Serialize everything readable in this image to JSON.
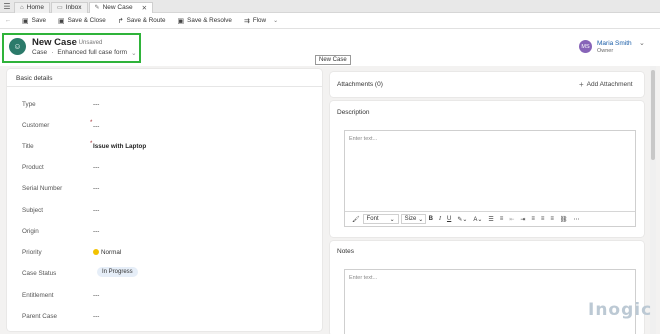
{
  "tabs": [
    {
      "label": "Home",
      "icon": "home-icon"
    },
    {
      "label": "Inbox",
      "icon": "inbox-icon"
    },
    {
      "label": "New Case",
      "icon": "edit-icon",
      "active": true
    }
  ],
  "commands": {
    "save": "Save",
    "save_close": "Save & Close",
    "save_route": "Save & Route",
    "save_resolve": "Save & Resolve",
    "flow": "Flow"
  },
  "record": {
    "title": "New Case",
    "status": "- Unsaved",
    "entity": "Case",
    "separator": "·",
    "form": "Enhanced full case form",
    "tooltip": "New Case"
  },
  "owner": {
    "initials": "MS",
    "name": "Maria Smith",
    "role": "Owner"
  },
  "basic_details": {
    "title": "Basic details",
    "fields": [
      {
        "label": "Type",
        "value": "---"
      },
      {
        "label": "Customer",
        "value": "---",
        "required": "*"
      },
      {
        "label": "Title",
        "value": "Issue with Laptop",
        "required": "*"
      },
      {
        "label": "Product",
        "value": "---"
      },
      {
        "label": "Serial Number",
        "value": "---"
      },
      {
        "label": "Subject",
        "value": "---"
      },
      {
        "label": "Origin",
        "value": "---"
      },
      {
        "label": "Priority",
        "value": "Normal"
      },
      {
        "label": "Case Status",
        "value": "In Progress"
      },
      {
        "label": "Entitlement",
        "value": "---"
      },
      {
        "label": "Parent Case",
        "value": "---"
      }
    ]
  },
  "attachments": {
    "title": "Attachments (0)",
    "add_label": "Add Attachment"
  },
  "description": {
    "title": "Description",
    "placeholder": "Enter text...",
    "font_label": "Font",
    "size_label": "Size"
  },
  "notes": {
    "title": "Notes",
    "placeholder": "Enter text..."
  },
  "watermark": "Inogic",
  "colors": {
    "highlight": "#2fb33a",
    "owner_avatar": "#8764b8",
    "record_icon": "#2b7a6a",
    "priority": "#f2c200"
  }
}
